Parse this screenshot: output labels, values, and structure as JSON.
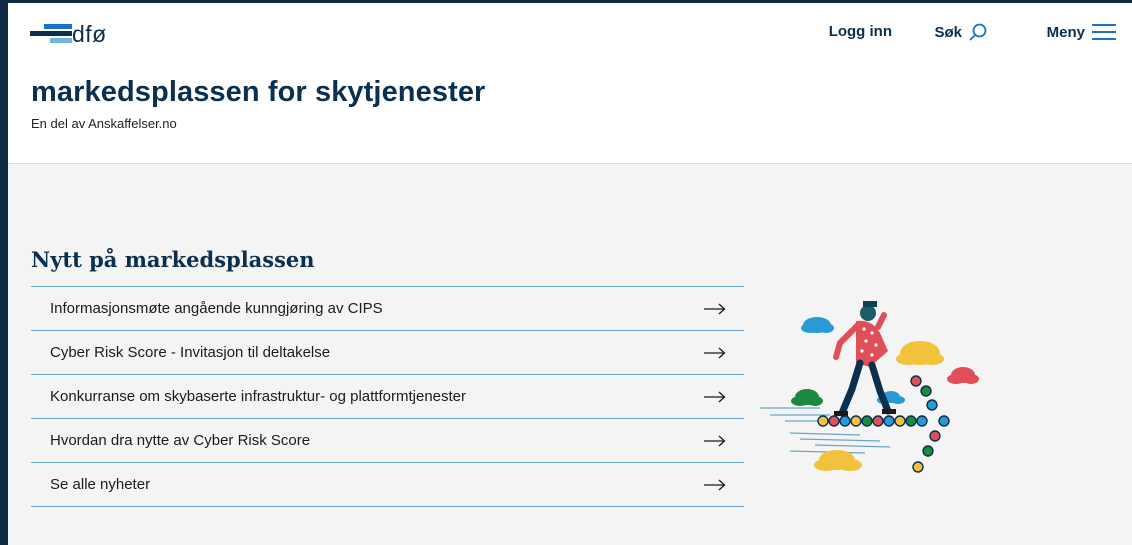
{
  "brand": {
    "logo_text": "dfø"
  },
  "nav": {
    "login_label": "Logg inn",
    "search_label": "Søk",
    "menu_label": "Meny"
  },
  "site": {
    "title": "markedsplassen for skytjenester",
    "subtitle": "En del av Anskaffelser.no"
  },
  "news": {
    "heading": "Nytt på markedsplassen",
    "items": [
      {
        "label": "Informasjonsmøte angående kunngjøring av CIPS"
      },
      {
        "label": "Cyber Risk Score - Invitasjon til deltakelse"
      },
      {
        "label": "Konkurranse om skybaserte infrastruktur- og plattformtjenester"
      },
      {
        "label": "Hvordan dra nytte av Cyber Risk Score"
      },
      {
        "label": "Se alle nyheter"
      }
    ]
  },
  "colors": {
    "brand_navy": "#0b2f4f",
    "accent_blue": "#1a73c9",
    "divider_blue": "#6aa5c4",
    "page_background": "#f4f4f4",
    "outer_frame": "#0e2a45"
  },
  "icons": {
    "search": "search-icon",
    "menu": "hamburger-icon",
    "list_arrow": "arrow-right-icon",
    "logo": "dfo-logo"
  }
}
